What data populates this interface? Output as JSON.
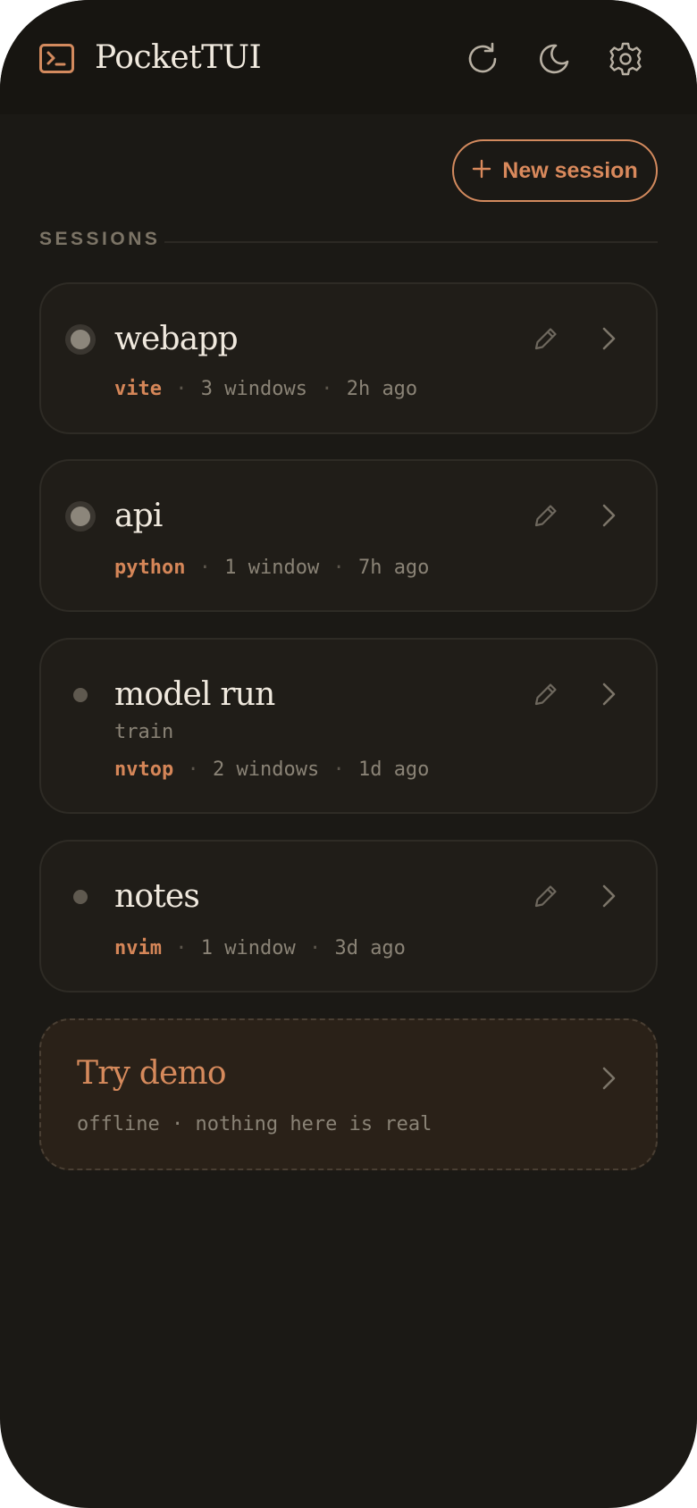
{
  "app": {
    "title": "PocketTUI"
  },
  "header": {
    "logo_icon": "terminal-icon",
    "actions": [
      {
        "name": "refresh",
        "icon": "refresh-icon"
      },
      {
        "name": "theme",
        "icon": "moon-icon"
      },
      {
        "name": "settings",
        "icon": "gear-icon"
      }
    ]
  },
  "toolbar": {
    "new_session_icon": "plus-icon",
    "new_session_label": "New session"
  },
  "sessions": {
    "section_label": "SESSIONS",
    "items": [
      {
        "name": "webapp",
        "subtitle": "",
        "status": "active",
        "command": "vite",
        "windows": "3 windows",
        "age": "2h ago"
      },
      {
        "name": "api",
        "subtitle": "",
        "status": "active",
        "command": "python",
        "windows": "1 window",
        "age": "7h ago"
      },
      {
        "name": "model run",
        "subtitle": "train",
        "status": "idle",
        "command": "nvtop",
        "windows": "2 windows",
        "age": "1d ago"
      },
      {
        "name": "notes",
        "subtitle": "",
        "status": "idle",
        "command": "nvim",
        "windows": "1 window",
        "age": "3d ago"
      }
    ],
    "separator": "·"
  },
  "demo": {
    "title": "Try demo",
    "subtitle": "offline · nothing here is real"
  },
  "colors": {
    "background": "#1b1915",
    "header": "#171511",
    "card": "#201d18",
    "accent": "#d9895c",
    "text": "#f0e9de",
    "muted": "#8a8376"
  }
}
